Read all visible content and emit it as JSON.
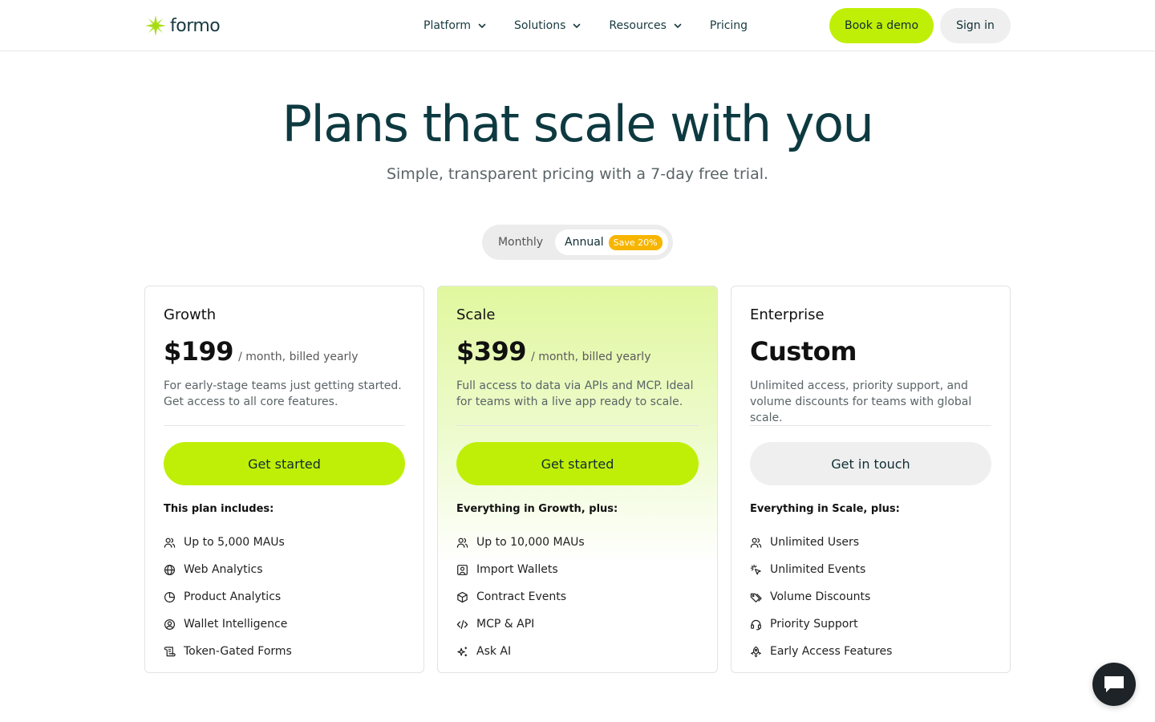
{
  "header": {
    "logo_text": "formo",
    "nav": [
      {
        "label": "Platform",
        "dropdown": true
      },
      {
        "label": "Solutions",
        "dropdown": true
      },
      {
        "label": "Resources",
        "dropdown": true
      },
      {
        "label": "Pricing",
        "dropdown": false
      }
    ],
    "book_demo": "Book a demo",
    "sign_in": "Sign in"
  },
  "hero": {
    "title": "Plans that scale with you",
    "subtitle": "Simple, transparent pricing with a 7-day free trial."
  },
  "billing_toggle": {
    "monthly": "Monthly",
    "annual": "Annual",
    "badge": "Save 20%",
    "selected": "Annual"
  },
  "plans": [
    {
      "name": "Growth",
      "price": "$199",
      "period": "/ month, billed yearly",
      "description": "For early-stage teams just getting started. Get access to all core features.",
      "cta": "Get started",
      "includes_heading": "This plan includes:",
      "features": [
        {
          "label": "Up to 5,000 MAUs",
          "icon": "users-icon"
        },
        {
          "label": "Web Analytics",
          "icon": "globe-icon"
        },
        {
          "label": "Product Analytics",
          "icon": "pie-chart-icon"
        },
        {
          "label": "Wallet Intelligence",
          "icon": "user-circle-icon"
        },
        {
          "label": "Token-Gated Forms",
          "icon": "scroll-icon"
        }
      ]
    },
    {
      "name": "Scale",
      "price": "$399",
      "period": "/ month, billed yearly",
      "description": "Full access to data via APIs and MCP. Ideal for teams with a live app ready to scale.",
      "cta": "Get started",
      "includes_heading": "Everything in Growth, plus:",
      "features": [
        {
          "label": "Up to 10,000 MAUs",
          "icon": "users-icon"
        },
        {
          "label": "Import Wallets",
          "icon": "user-square-icon"
        },
        {
          "label": "Contract Events",
          "icon": "box-icon"
        },
        {
          "label": "MCP & API",
          "icon": "code-icon"
        },
        {
          "label": "Ask AI",
          "icon": "sparkles-icon"
        }
      ]
    },
    {
      "name": "Enterprise",
      "price": "Custom",
      "period": "",
      "description": "Unlimited access, priority support, and volume discounts for teams with global scale.",
      "cta": "Get in touch",
      "includes_heading": "Everything in Scale, plus:",
      "features": [
        {
          "label": "Unlimited Users",
          "icon": "users-icon"
        },
        {
          "label": "Unlimited Events",
          "icon": "click-icon"
        },
        {
          "label": "Volume Discounts",
          "icon": "tags-icon"
        },
        {
          "label": "Priority Support",
          "icon": "headset-icon"
        },
        {
          "label": "Early Access Features",
          "icon": "rocket-icon"
        }
      ]
    }
  ],
  "colors": {
    "accent": "#c0ef07",
    "heading": "#0d3a40",
    "badge": "#f7b500"
  }
}
